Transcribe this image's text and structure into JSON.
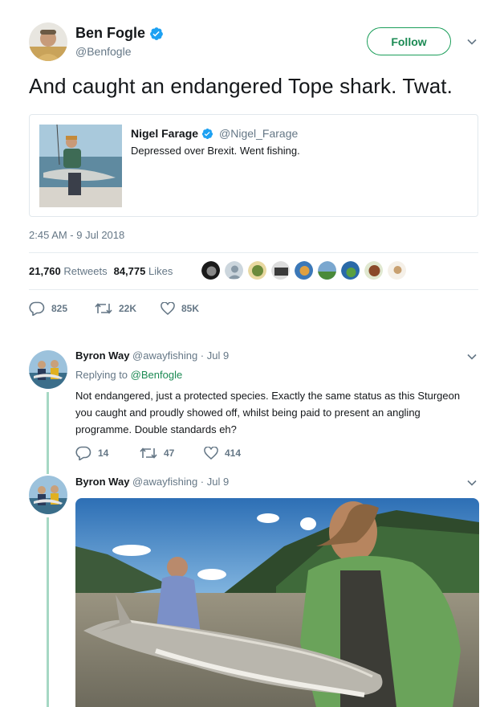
{
  "main_tweet": {
    "author_name": "Ben Fogle",
    "author_handle": "@Benfogle",
    "follow_label": "Follow",
    "text": "And caught an endangered Tope shark. Twat.",
    "timestamp": "2:45 AM - 9 Jul 2018",
    "retweets_count": "21,760",
    "retweets_label": "Retweets",
    "likes_count": "84,775",
    "likes_label": "Likes",
    "actions": {
      "replies": "825",
      "retweets": "22K",
      "likes": "85K"
    }
  },
  "quoted_tweet": {
    "author_name": "Nigel Farage",
    "author_handle": "@Nigel_Farage",
    "text": "Depressed over Brexit. Went fishing."
  },
  "reply_1": {
    "author_name": "Byron Way",
    "author_handle": "@awayfishing",
    "date": "· Jul 9",
    "replying_label": "Replying to",
    "replying_handle": "@Benfogle",
    "text": "Not endangered, just a protected species. Exactly the same status as this Sturgeon you caught and proudly showed off, whilst being paid to present an angling programme. Double standards eh?",
    "actions": {
      "replies": "14",
      "retweets": "47",
      "likes": "414"
    }
  },
  "reply_2": {
    "author_name": "Byron Way",
    "author_handle": "@awayfishing",
    "date": "· Jul 9"
  },
  "icons": [
    "verified-icon",
    "chevron-down-icon",
    "reply-icon",
    "retweet-icon",
    "heart-icon"
  ],
  "colors": {
    "accent_green": "#1b8a53",
    "verified_blue": "#1da1f2",
    "muted": "#657786",
    "thread_line": "#a6d8c4"
  }
}
